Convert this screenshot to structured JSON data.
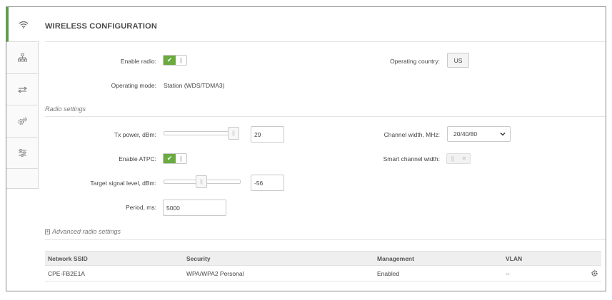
{
  "page": {
    "title": "WIRELESS CONFIGURATION"
  },
  "sidebar": {
    "items": [
      {
        "icon": "wifi-icon",
        "active": true
      },
      {
        "icon": "network-icon",
        "active": false
      },
      {
        "icon": "arrows-icon",
        "active": false
      },
      {
        "icon": "gears-icon",
        "active": false
      },
      {
        "icon": "sliders-icon",
        "active": false
      }
    ]
  },
  "general": {
    "enable_radio_label": "Enable radio:",
    "enable_radio_on": true,
    "operating_country_label": "Operating country:",
    "operating_country_value": "US",
    "operating_mode_label": "Operating mode:",
    "operating_mode_value": "Station (WDS/TDMA3)"
  },
  "radio": {
    "section_title": "Radio settings",
    "tx_power_label": "Tx power, dBm:",
    "tx_power_value": "29",
    "tx_power_slider_fraction": 0.95,
    "channel_width_label": "Channel width, MHz:",
    "channel_width_value": "20/40/80",
    "enable_atpc_label": "Enable ATPC:",
    "enable_atpc_on": true,
    "smart_channel_width_label": "Smart channel width:",
    "target_signal_label": "Target signal level, dBm:",
    "target_signal_value": "-56",
    "target_signal_slider_fraction": 0.5,
    "period_label": "Period, ms:",
    "period_value": "5000"
  },
  "advanced": {
    "label": "Advanced radio settings",
    "expand_symbol": "+"
  },
  "ssid_table": {
    "headers": [
      "Network SSID",
      "Security",
      "Management",
      "VLAN"
    ],
    "rows": [
      {
        "ssid": "CPE-FB2E1A",
        "security": "WPA/WPA2 Personal",
        "management": "Enabled",
        "vlan": "--"
      }
    ]
  },
  "colors": {
    "accent_green": "#6aaa3f",
    "border_gray": "#c9c9c9"
  }
}
